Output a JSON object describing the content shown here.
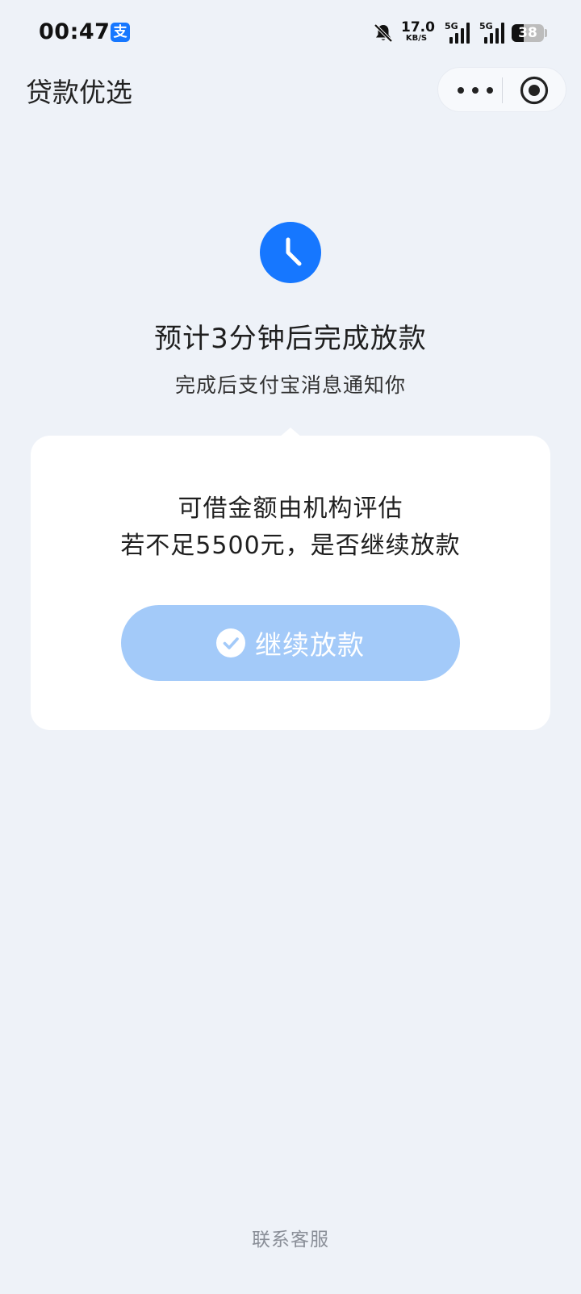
{
  "status_bar": {
    "time": "00:47",
    "app_badge": "支",
    "net_speed_value": "17.0",
    "net_speed_unit": "KB/S",
    "signal_1_label": "5G",
    "signal_2_label": "5G",
    "battery_level": "38",
    "battery_fraction": 0.38,
    "icons": [
      "alipay-icon",
      "mute-bell-icon",
      "signal-icon",
      "battery-icon"
    ]
  },
  "nav": {
    "title": "贷款优选",
    "more_icon": "more-dots-icon",
    "close_icon": "target-circle-icon"
  },
  "main": {
    "status_icon": "clock-icon",
    "title": "预计3分钟后完成放款",
    "subtitle": "完成后支付宝消息通知你"
  },
  "card": {
    "line_1": "可借金额由机构评估",
    "line_2": "若不足5500元，是否继续放款",
    "button_label": "继续放款",
    "button_icon": "check-circle-icon"
  },
  "footer": {
    "contact_label": "联系客服"
  },
  "colors": {
    "background": "#eef2f8",
    "accent": "#1677ff",
    "button": "#a3caf9",
    "card": "#ffffff",
    "muted_text": "#8a8f98"
  }
}
